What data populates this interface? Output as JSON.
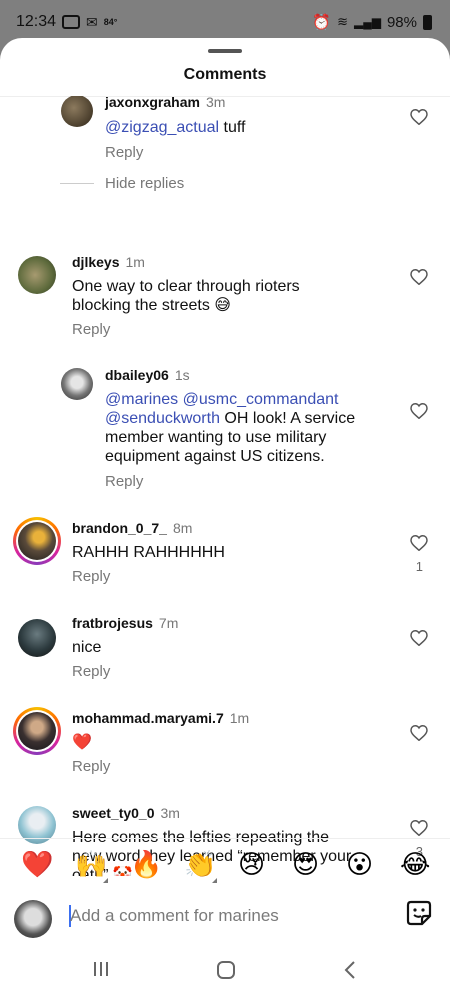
{
  "status": {
    "time": "12:34",
    "temp": "84°",
    "battery": "98%"
  },
  "sheet": {
    "title": "Comments"
  },
  "comments": [
    {
      "user": "jaxonxgraham",
      "time": "3m",
      "mentions": [
        "@zigzag_actual"
      ],
      "text": " tuff",
      "reply": "Reply",
      "likes": ""
    },
    {
      "hide_replies": "Hide replies"
    },
    {
      "user": "djlkeys",
      "time": "1m",
      "line1": "One way to clear through rioters",
      "line2": "blocking the streets 😅",
      "reply": "Reply",
      "likes": ""
    },
    {
      "user": "dbailey06",
      "time": "1s",
      "mention_line1": "@marines @usmc_commandant",
      "mention_line2": "@senduckworth",
      "rest_line2": " OH look! A service",
      "line3": "member wanting to use military",
      "line4": "equipment against US citizens.",
      "reply": "Reply",
      "likes": ""
    },
    {
      "user": "brandon_0_7_",
      "time": "8m",
      "text": "RAHHH RAHHHHHH",
      "reply": "Reply",
      "likes": "1"
    },
    {
      "user": "fratbrojesus",
      "time": "7m",
      "text": "nice",
      "reply": "Reply",
      "likes": ""
    },
    {
      "user": "mohammad.maryami.7",
      "time": "1m",
      "text": "❤️",
      "reply": "Reply",
      "likes": ""
    },
    {
      "user": "sweet_ty0_0",
      "time": "3m",
      "line1": "Here comes the lefties repeating the",
      "line2": "new word they learned “remember your",
      "line3": "oath” 🤡",
      "likes": "3"
    }
  ],
  "emoji_bar": [
    "❤️",
    "🙌",
    "🔥",
    "👏",
    "😢",
    "😍",
    "😮",
    "😂"
  ],
  "input": {
    "placeholder": "Add a comment for marines"
  },
  "colors": {
    "mention": "#3b4fb4",
    "heart_filled": "#ed1c2b",
    "caret": "#3b6ff0"
  }
}
